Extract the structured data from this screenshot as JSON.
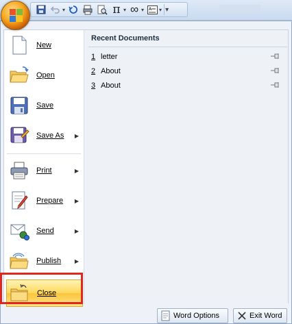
{
  "quick_access": {
    "icons": [
      "office-button-icon",
      "save-icon",
      "undo-icon",
      "redo-icon",
      "print-preview-icon",
      "equation-icon",
      "infinity-icon",
      "textbox-icon",
      "customize-dropdown-icon"
    ],
    "equation_symbol": "π",
    "infinity_symbol": "∞"
  },
  "menu": {
    "commands": [
      {
        "label": "New",
        "has_submenu": false
      },
      {
        "label": "Open",
        "has_submenu": false
      },
      {
        "label": "Save",
        "has_submenu": false
      },
      {
        "label": "Save As",
        "has_submenu": true
      },
      {
        "label": "Print",
        "has_submenu": true
      },
      {
        "label": "Prepare",
        "has_submenu": true
      },
      {
        "label": "Send",
        "has_submenu": true
      },
      {
        "label": "Publish",
        "has_submenu": true
      },
      {
        "label": "Close",
        "has_submenu": false
      }
    ],
    "recent": {
      "title": "Recent Documents",
      "items": [
        {
          "num": "1",
          "name": "letter"
        },
        {
          "num": "2",
          "name": "About"
        },
        {
          "num": "3",
          "name": "About"
        }
      ]
    },
    "footer": {
      "options_label": "Word Options",
      "exit_label": "Exit Word"
    }
  },
  "colors": {
    "highlight_border": "#e0261f",
    "office_orange": "#f6a41d",
    "menu_bg": "#eef2f8"
  }
}
